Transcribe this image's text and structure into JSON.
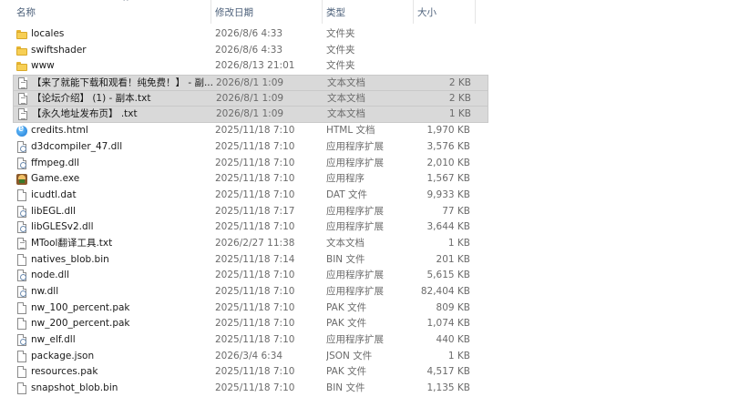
{
  "columns": {
    "name": "名称",
    "date": "修改日期",
    "type": "类型",
    "size": "大小"
  },
  "files": [
    {
      "name": "locales",
      "date": "2026/8/6 4:33",
      "type": "文件夹",
      "size": "",
      "icon": "folder-icon",
      "selected": false
    },
    {
      "name": "swiftshader",
      "date": "2026/8/6 4:33",
      "type": "文件夹",
      "size": "",
      "icon": "folder-icon",
      "selected": false
    },
    {
      "name": "www",
      "date": "2026/8/13 21:01",
      "type": "文件夹",
      "size": "",
      "icon": "folder-icon",
      "selected": false
    },
    {
      "name": "【来了就能下载和观看！纯免费！】 - 副...",
      "date": "2026/8/1 1:09",
      "type": "文本文档",
      "size": "2 KB",
      "icon": "txt-icon",
      "selected": true
    },
    {
      "name": "【论坛介绍】 (1) - 副本.txt",
      "date": "2026/8/1 1:09",
      "type": "文本文档",
      "size": "2 KB",
      "icon": "txt-icon",
      "selected": true
    },
    {
      "name": "【永久地址发布页】 .txt",
      "date": "2026/8/1 1:09",
      "type": "文本文档",
      "size": "1 KB",
      "icon": "txt-icon",
      "selected": true
    },
    {
      "name": "credits.html",
      "date": "2025/11/18 7:10",
      "type": "HTML 文档",
      "size": "1,970 KB",
      "icon": "html-icon",
      "selected": false
    },
    {
      "name": "d3dcompiler_47.dll",
      "date": "2025/11/18 7:10",
      "type": "应用程序扩展",
      "size": "3,576 KB",
      "icon": "dll-icon",
      "selected": false
    },
    {
      "name": "ffmpeg.dll",
      "date": "2025/11/18 7:10",
      "type": "应用程序扩展",
      "size": "2,010 KB",
      "icon": "dll-icon",
      "selected": false
    },
    {
      "name": "Game.exe",
      "date": "2025/11/18 7:10",
      "type": "应用程序",
      "size": "1,567 KB",
      "icon": "exe-icon",
      "selected": false
    },
    {
      "name": "icudtl.dat",
      "date": "2025/11/18 7:10",
      "type": "DAT 文件",
      "size": "9,933 KB",
      "icon": "file-icon",
      "selected": false
    },
    {
      "name": "libEGL.dll",
      "date": "2025/11/18 7:17",
      "type": "应用程序扩展",
      "size": "77 KB",
      "icon": "dll-icon",
      "selected": false
    },
    {
      "name": "libGLESv2.dll",
      "date": "2025/11/18 7:10",
      "type": "应用程序扩展",
      "size": "3,644 KB",
      "icon": "dll-icon",
      "selected": false
    },
    {
      "name": "MTool翻译工具.txt",
      "date": "2026/2/27 11:38",
      "type": "文本文档",
      "size": "1 KB",
      "icon": "txt-icon",
      "selected": false
    },
    {
      "name": "natives_blob.bin",
      "date": "2025/11/18 7:14",
      "type": "BIN 文件",
      "size": "201 KB",
      "icon": "file-icon",
      "selected": false
    },
    {
      "name": "node.dll",
      "date": "2025/11/18 7:10",
      "type": "应用程序扩展",
      "size": "5,615 KB",
      "icon": "dll-icon",
      "selected": false
    },
    {
      "name": "nw.dll",
      "date": "2025/11/18 7:10",
      "type": "应用程序扩展",
      "size": "82,404 KB",
      "icon": "dll-icon",
      "selected": false
    },
    {
      "name": "nw_100_percent.pak",
      "date": "2025/11/18 7:10",
      "type": "PAK 文件",
      "size": "809 KB",
      "icon": "file-icon",
      "selected": false
    },
    {
      "name": "nw_200_percent.pak",
      "date": "2025/11/18 7:10",
      "type": "PAK 文件",
      "size": "1,074 KB",
      "icon": "file-icon",
      "selected": false
    },
    {
      "name": "nw_elf.dll",
      "date": "2025/11/18 7:10",
      "type": "应用程序扩展",
      "size": "440 KB",
      "icon": "dll-icon",
      "selected": false
    },
    {
      "name": "package.json",
      "date": "2026/3/4 6:34",
      "type": "JSON 文件",
      "size": "1 KB",
      "icon": "file-icon",
      "selected": false
    },
    {
      "name": "resources.pak",
      "date": "2025/11/18 7:10",
      "type": "PAK 文件",
      "size": "4,517 KB",
      "icon": "file-icon",
      "selected": false
    },
    {
      "name": "snapshot_blob.bin",
      "date": "2025/11/18 7:10",
      "type": "BIN 文件",
      "size": "1,135 KB",
      "icon": "file-icon",
      "selected": false
    }
  ]
}
